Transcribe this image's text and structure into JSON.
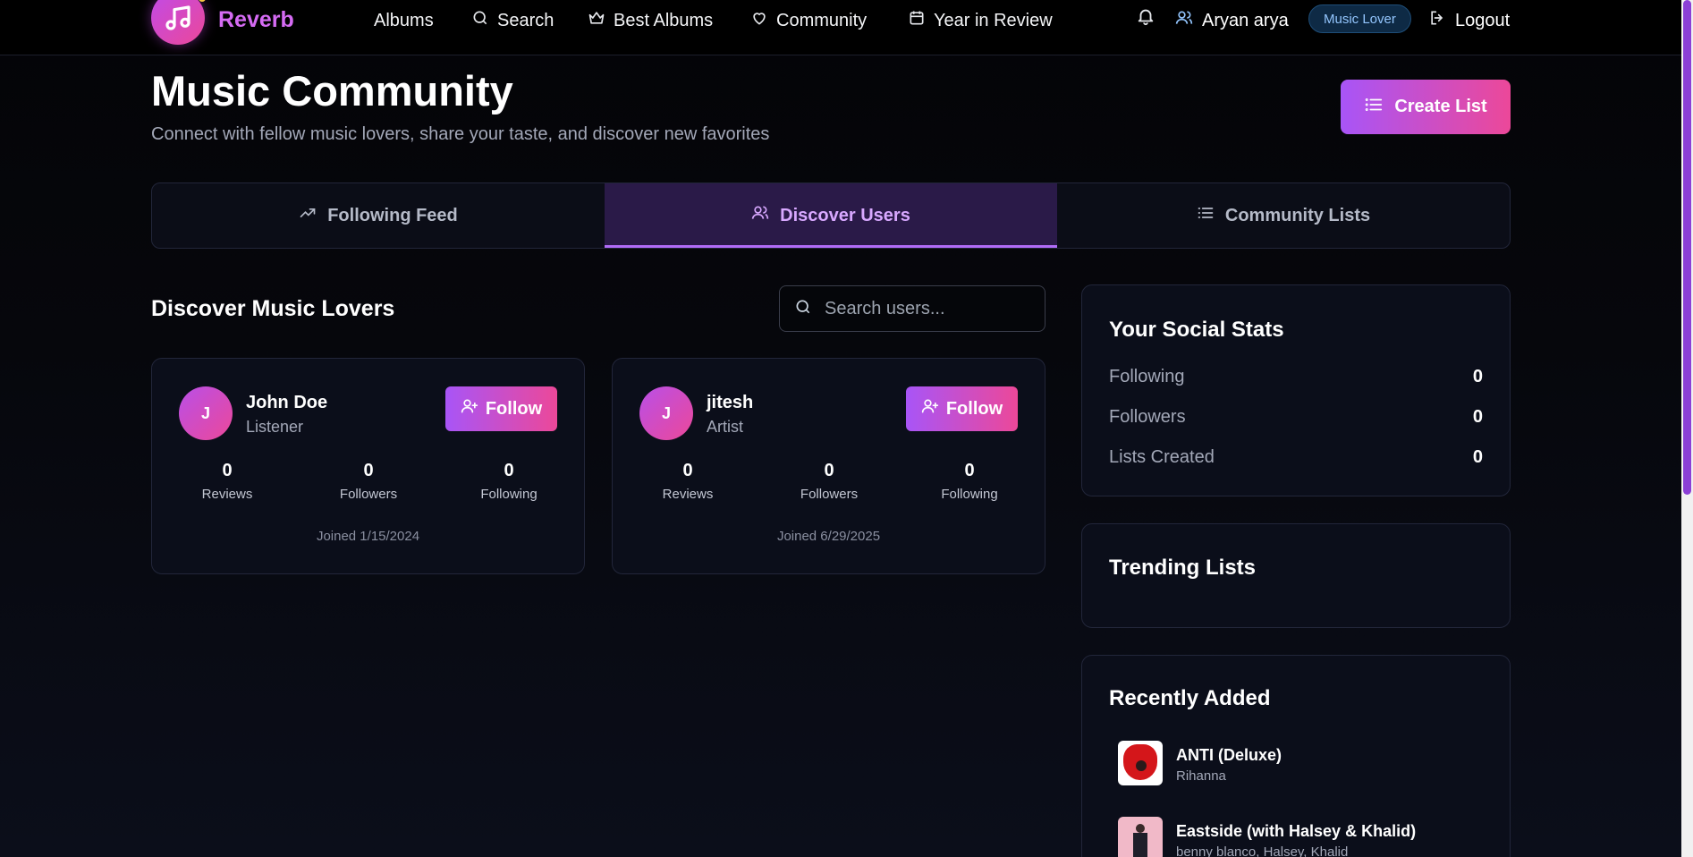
{
  "nav": {
    "brand": "Reverb",
    "items": [
      {
        "label": "Albums",
        "icon": "none"
      },
      {
        "label": "Search",
        "icon": "search-icon"
      },
      {
        "label": "Best Albums",
        "icon": "crown-icon"
      },
      {
        "label": "Community",
        "icon": "heart-icon"
      },
      {
        "label": "Year in Review",
        "icon": "calendar-icon"
      }
    ],
    "user_name": "Aryan arya",
    "role_badge": "Music Lover",
    "logout": "Logout"
  },
  "header": {
    "title": "Music Community",
    "subtitle": "Connect with fellow music lovers, share your taste, and discover new favorites",
    "create_button": "Create List"
  },
  "tabs": [
    {
      "label": "Following Feed",
      "active": false
    },
    {
      "label": "Discover Users",
      "active": true
    },
    {
      "label": "Community Lists",
      "active": false
    }
  ],
  "discover": {
    "title": "Discover Music Lovers",
    "search_placeholder": "Search users...",
    "follow_label": "Follow",
    "users": [
      {
        "initial": "J",
        "name": "John Doe",
        "role": "Listener",
        "reviews": "0",
        "followers": "0",
        "following": "0",
        "joined": "Joined 1/15/2024"
      },
      {
        "initial": "J",
        "name": "jitesh",
        "role": "Artist",
        "reviews": "0",
        "followers": "0",
        "following": "0",
        "joined": "Joined 6/29/2025"
      }
    ],
    "stat_labels": {
      "reviews": "Reviews",
      "followers": "Followers",
      "following": "Following"
    }
  },
  "sidebar": {
    "social_title": "Your Social Stats",
    "social_stats": [
      {
        "label": "Following",
        "value": "0"
      },
      {
        "label": "Followers",
        "value": "0"
      },
      {
        "label": "Lists Created",
        "value": "0"
      }
    ],
    "trending_title": "Trending Lists",
    "recent_title": "Recently Added",
    "recent": [
      {
        "title": "ANTI (Deluxe)",
        "artist": "Rihanna"
      },
      {
        "title": "Eastside (with Halsey & Khalid)",
        "artist": "benny blanco, Halsey, Khalid"
      }
    ]
  },
  "colors": {
    "accent_gradient_start": "#a855f7",
    "accent_gradient_end": "#ec4899",
    "badge_text": "#93c5fd"
  }
}
